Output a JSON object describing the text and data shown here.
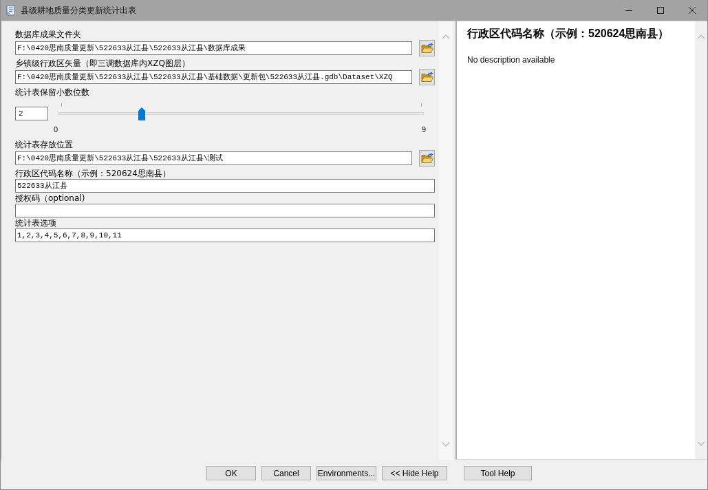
{
  "window": {
    "title": "县级耕地质量分类更新统计出表"
  },
  "parameters": [
    {
      "kind": "path",
      "label": "数据库成果文件夹",
      "value": "F:\\0420思南质量更新\\522633从江县\\522633从江县\\数据库成果"
    },
    {
      "kind": "path",
      "label": "乡镇级行政区矢量（即三调数据库内XZQ图层）",
      "value": "F:\\0420思南质量更新\\522633从江县\\522633从江县\\基础数据\\更新包\\522633从江县.gdb\\Dataset\\XZQ"
    },
    {
      "kind": "slider",
      "label": "统计表保留小数位数",
      "value": "2",
      "level": 0.222,
      "min_label": "0",
      "max_label": "9"
    },
    {
      "kind": "path",
      "label": "统计表存放位置",
      "value": "F:\\0420思南质量更新\\522633从江县\\522633从江县\\测试"
    },
    {
      "kind": "text",
      "label": "行政区代码名称（示例：520624思南县）",
      "value": "522633从江县"
    },
    {
      "kind": "text",
      "label": "授权码（optional)"
    },
    {
      "kind": "text",
      "label": "统计表选项",
      "value": "1,2,3,4,5,6,7,8,9,10,11"
    }
  ],
  "help": {
    "title": "行政区代码名称（示例：520624思南县）",
    "description": "No description available"
  },
  "buttons": [
    "OK",
    "Cancel",
    "Environments...",
    "<< Hide Help",
    "Tool Help"
  ]
}
